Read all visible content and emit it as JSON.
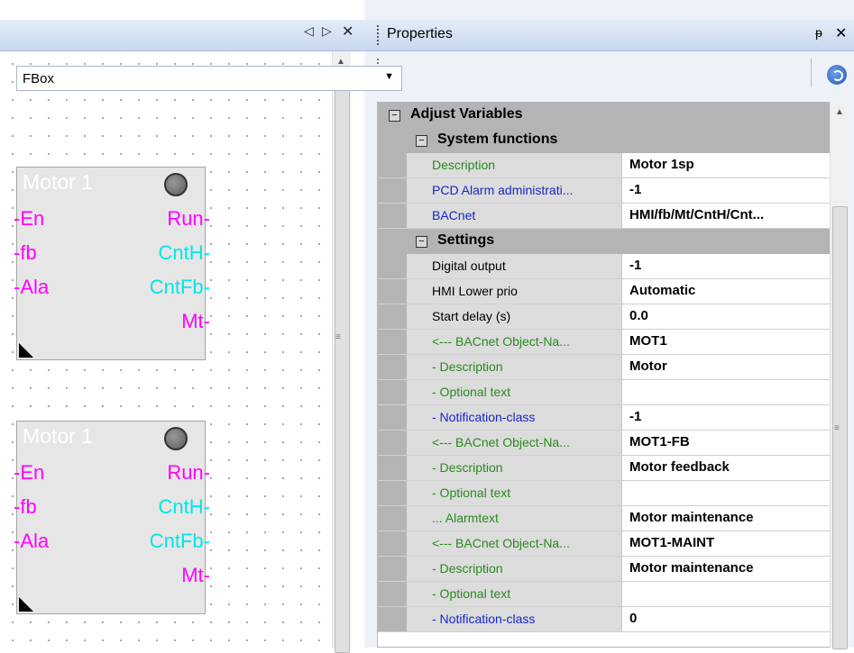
{
  "left_panel": {
    "controls": {
      "prev": "◁",
      "next": "▷",
      "close": "✕"
    },
    "fboxes": [
      {
        "title": "Motor 1",
        "inputs": [
          "-En",
          "-fb",
          "-Ala"
        ],
        "outputs": [
          {
            "label": "Run-",
            "color": "#ff00ff"
          },
          {
            "label": "CntH-",
            "color": "#00e6e6"
          },
          {
            "label": "CntFb-",
            "color": "#00e6e6"
          },
          {
            "label": "Mt-",
            "color": "#ff00ff"
          }
        ]
      },
      {
        "title": "Motor 1",
        "inputs": [
          "-En",
          "-fb",
          "-Ala"
        ],
        "outputs": [
          {
            "label": "Run-",
            "color": "#ff00ff"
          },
          {
            "label": "CntH-",
            "color": "#00e6e6"
          },
          {
            "label": "CntFb-",
            "color": "#00e6e6"
          },
          {
            "label": "Mt-",
            "color": "#ff00ff"
          }
        ]
      }
    ]
  },
  "properties": {
    "title": "Properties",
    "pin_glyph": "ᵽ",
    "close_glyph": "✕",
    "object_select": {
      "value": "FBox"
    },
    "categories": [
      {
        "label": "Adjust Variables",
        "level": 0,
        "expander": "−"
      },
      {
        "label": "System functions",
        "level": 1,
        "expander": "−",
        "rows": [
          {
            "name": "Description",
            "value": "Motor 1sp",
            "color": "green"
          },
          {
            "name": "PCD Alarm administrati...",
            "value": "-1",
            "color": "blue"
          },
          {
            "name": "BACnet",
            "value": "HMI/fb/Mt/CntH/Cnt...",
            "color": "blue"
          }
        ]
      },
      {
        "label": "Settings",
        "level": 1,
        "expander": "−",
        "rows": [
          {
            "name": "Digital output",
            "value": "-1",
            "color": "black"
          },
          {
            "name": "HMI Lower prio",
            "value": "Automatic",
            "color": "black"
          },
          {
            "name": "Start delay (s)",
            "value": "0.0",
            "color": "black"
          },
          {
            "name": "<--- BACnet Object-Na...",
            "value": "MOT1",
            "color": "green"
          },
          {
            "name": "- Description",
            "value": "Motor",
            "color": "green"
          },
          {
            "name": "- Optional text",
            "value": "",
            "color": "green"
          },
          {
            "name": "- Notification-class",
            "value": "-1",
            "color": "blue"
          },
          {
            "name": "<--- BACnet Object-Na...",
            "value": "MOT1-FB",
            "color": "green"
          },
          {
            "name": "- Description",
            "value": "Motor feedback",
            "color": "green"
          },
          {
            "name": "- Optional text",
            "value": "",
            "color": "green"
          },
          {
            "name": "... Alarmtext",
            "value": "Motor maintenance",
            "color": "green"
          },
          {
            "name": "<--- BACnet Object-Na...",
            "value": "MOT1-MAINT",
            "color": "green"
          },
          {
            "name": "- Description",
            "value": "Motor maintenance",
            "color": "green"
          },
          {
            "name": "- Optional text",
            "value": "",
            "color": "green"
          },
          {
            "name": "- Notification-class",
            "value": "0",
            "color": "blue"
          }
        ]
      }
    ]
  }
}
